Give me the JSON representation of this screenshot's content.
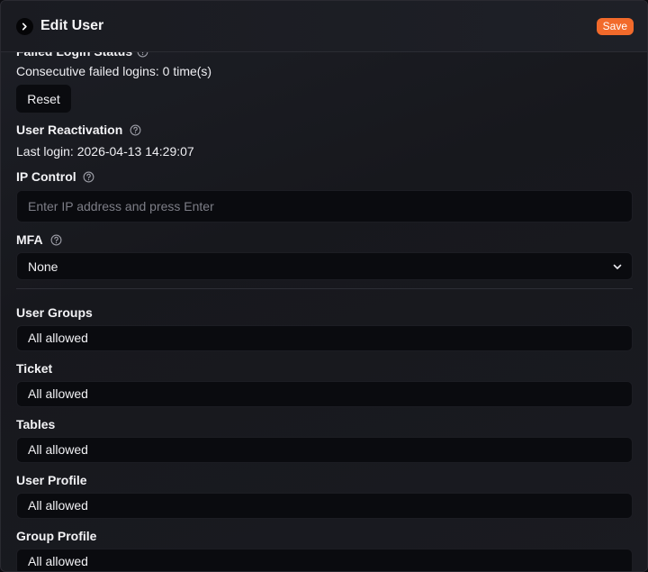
{
  "header": {
    "title": "Edit User",
    "save_label": "Save"
  },
  "failed_login": {
    "title": "Failed Login Status",
    "status_text": "Consecutive failed logins: 0 time(s)",
    "reset_label": "Reset"
  },
  "reactivation": {
    "title": "User Reactivation",
    "last_login_text": "Last login: 2026-04-13 14:29:07"
  },
  "ip_control": {
    "title": "IP Control",
    "placeholder": "Enter IP address and press Enter",
    "value": ""
  },
  "mfa": {
    "title": "MFA",
    "selected": "None"
  },
  "permissions": [
    {
      "label": "User Groups",
      "value": "All allowed"
    },
    {
      "label": "Ticket",
      "value": "All allowed"
    },
    {
      "label": "Tables",
      "value": "All allowed"
    },
    {
      "label": "User Profile",
      "value": "All allowed"
    },
    {
      "label": "Group Profile",
      "value": "All allowed"
    }
  ],
  "colors": {
    "accent": "#f26a2b",
    "background": "#1b1c22",
    "field_background": "#0a0b0f"
  },
  "icons": {
    "collapse": "chevron-right-icon",
    "help": "help-circle-icon",
    "dropdown": "chevron-down-icon"
  }
}
